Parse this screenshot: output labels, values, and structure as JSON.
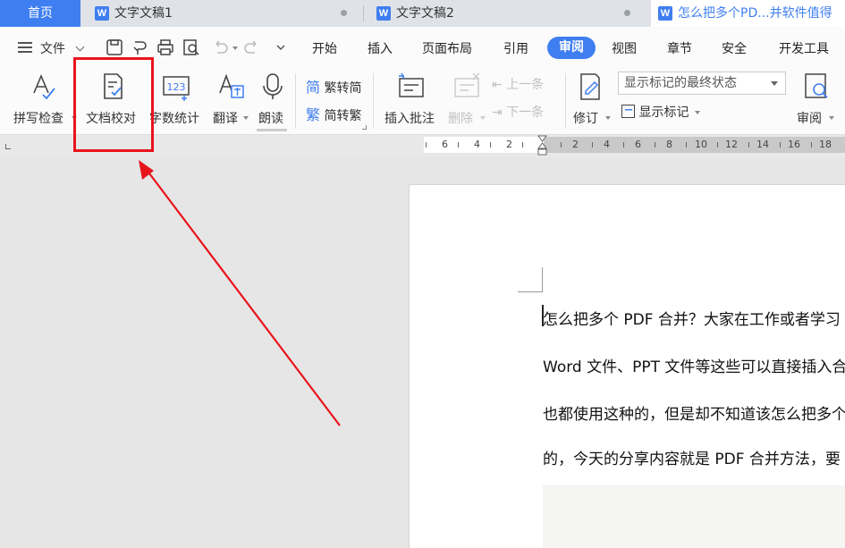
{
  "tabs": {
    "home": "首页",
    "docs": [
      {
        "title": "文字文稿1",
        "active": false
      },
      {
        "title": "文字文稿2",
        "active": false
      },
      {
        "title": "怎么把多个PD...并软件值得",
        "active": true
      }
    ],
    "doc_icon_letter": "W"
  },
  "menu": {
    "file_label": "文件",
    "items": [
      "开始",
      "插入",
      "页面布局",
      "引用",
      "视图",
      "章节",
      "安全",
      "开发工具"
    ],
    "active_item": "审阅"
  },
  "ribbon": {
    "spellcheck": "拼写检查",
    "doc_proofread": "文档校对",
    "word_count": "字数统计",
    "translate": "翻译",
    "read_aloud": "朗读",
    "trad_to_simp": "繁转简",
    "simp_to_trad": "简转繁",
    "insert_comment": "插入批注",
    "delete": "删除",
    "previous": "上一条",
    "next": "下一条",
    "track_changes": "修订",
    "markup_state": "显示标记的最终状态",
    "show_markup": "显示标记",
    "review": "审阅",
    "word_count_icon_text": "123"
  },
  "ruler": {
    "left_ticks": [
      "6",
      "4",
      "2"
    ],
    "right_ticks": [
      "2",
      "4",
      "6",
      "8",
      "10",
      "12",
      "14",
      "16",
      "18"
    ]
  },
  "document": {
    "lines": [
      "怎么把多个 PDF 合并？大家在工作或者学习",
      "Word 文件、PPT 文件等这些可以直接插入合",
      "也都使用这种的，但是却不知道该怎么把多个",
      "的，今天的分享内容就是 PDF 合并方法，要"
    ]
  },
  "colors": {
    "accent": "#3f7ef0",
    "annotation_red": "#e8141c"
  }
}
